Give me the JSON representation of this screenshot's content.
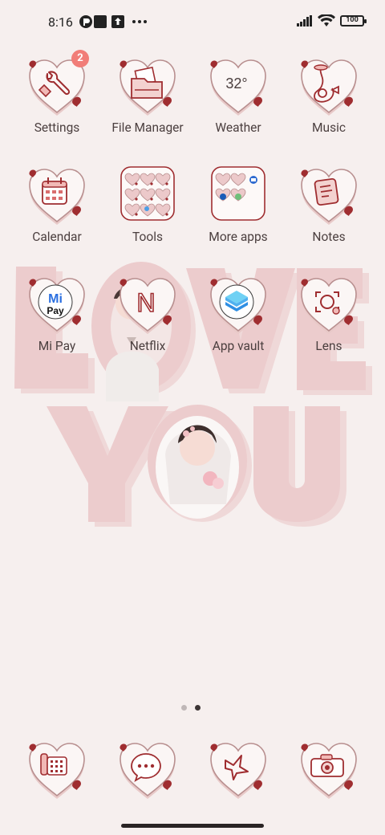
{
  "status_bar": {
    "time": "8:16",
    "battery": "100",
    "icons": [
      "tuya-icon",
      "square-icon",
      "upload-icon",
      "more-dots-icon",
      "signal-icon",
      "wifi-icon",
      "battery-icon"
    ]
  },
  "apps": [
    {
      "label": "Settings",
      "icon": "wrench-icon",
      "badge": "2"
    },
    {
      "label": "File Manager",
      "icon": "folder-icon"
    },
    {
      "label": "Weather",
      "icon": "weather-icon",
      "temp": "32°"
    },
    {
      "label": "Music",
      "icon": "music-icon"
    },
    {
      "label": "Calendar",
      "icon": "calendar-icon"
    },
    {
      "label": "Tools",
      "icon": "folder-tools-icon"
    },
    {
      "label": "More apps",
      "icon": "folder-more-apps-icon"
    },
    {
      "label": "Notes",
      "icon": "notes-icon"
    },
    {
      "label": "Mi Pay",
      "icon": "mi-pay-icon",
      "logo_top": "Mi",
      "logo_bottom": "Pay"
    },
    {
      "label": "Netflix",
      "icon": "netflix-icon",
      "letter": "N"
    },
    {
      "label": "App vault",
      "icon": "app-vault-icon"
    },
    {
      "label": "Lens",
      "icon": "lens-icon"
    }
  ],
  "wallpaper": {
    "line1": "LOVE",
    "line2": "YOU"
  },
  "page_indicator": {
    "pages": 2,
    "current": 2
  },
  "dock": [
    {
      "name": "phone",
      "icon": "phone-icon"
    },
    {
      "name": "messages",
      "icon": "messages-icon"
    },
    {
      "name": "browser",
      "icon": "browser-icon"
    },
    {
      "name": "camera",
      "icon": "camera-icon"
    }
  ],
  "colors": {
    "background": "#f6efee",
    "heart_fill": "#fbf6f5",
    "heart_shadow": "#e8c9c8",
    "heart_stroke": "#b88f8f",
    "accent_red": "#9f2d30",
    "badge": "#f17d78",
    "label": "#4b3f3f",
    "wallpaper_letters": "#ecc9ca"
  }
}
